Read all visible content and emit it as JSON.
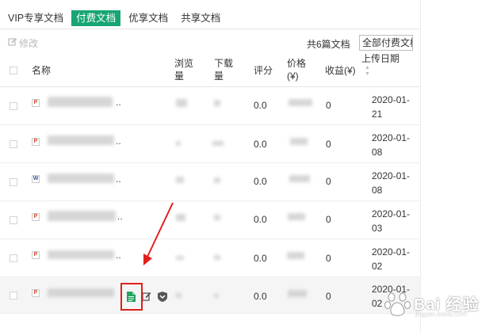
{
  "tabs": [
    {
      "label": "VIP专享文档",
      "active": false
    },
    {
      "label": "付费文档",
      "active": true
    },
    {
      "label": "优享文档",
      "active": false
    },
    {
      "label": "共享文档",
      "active": false
    }
  ],
  "toolbar": {
    "edit_label": "修改",
    "total_label": "共6篇文档",
    "filter_selected": "全部付费文档"
  },
  "table": {
    "headers": {
      "name": "名称",
      "views": "浏览量",
      "downloads": "下载量",
      "rating": "评分",
      "price": "价格(¥)",
      "income": "收益(¥)",
      "upload_date": "上传日期"
    },
    "rows": [
      {
        "type": "ppt",
        "rating": "0.0",
        "income": "0",
        "date": "2020-01-21"
      },
      {
        "type": "ppt",
        "rating": "0.0",
        "income": "0",
        "date": "2020-01-08"
      },
      {
        "type": "doc",
        "rating": "0.0",
        "income": "0",
        "date": "2020-01-08"
      },
      {
        "type": "ppt",
        "rating": "0.0",
        "income": "0",
        "date": "2020-01-03"
      },
      {
        "type": "ppt",
        "rating": "0.0",
        "income": "0",
        "date": "2020-01-02"
      },
      {
        "type": "ppt",
        "rating": "0.0",
        "income": "0",
        "date": "2020-01-02"
      }
    ],
    "truncation": "..",
    "type_glyphs": {
      "ppt": "P",
      "doc": "W"
    }
  },
  "watermark": {
    "text": "Bai 经验",
    "sub": "jingyan.baidu.com"
  },
  "colors": {
    "accent": "#17a673",
    "highlight": "#e0201b"
  }
}
